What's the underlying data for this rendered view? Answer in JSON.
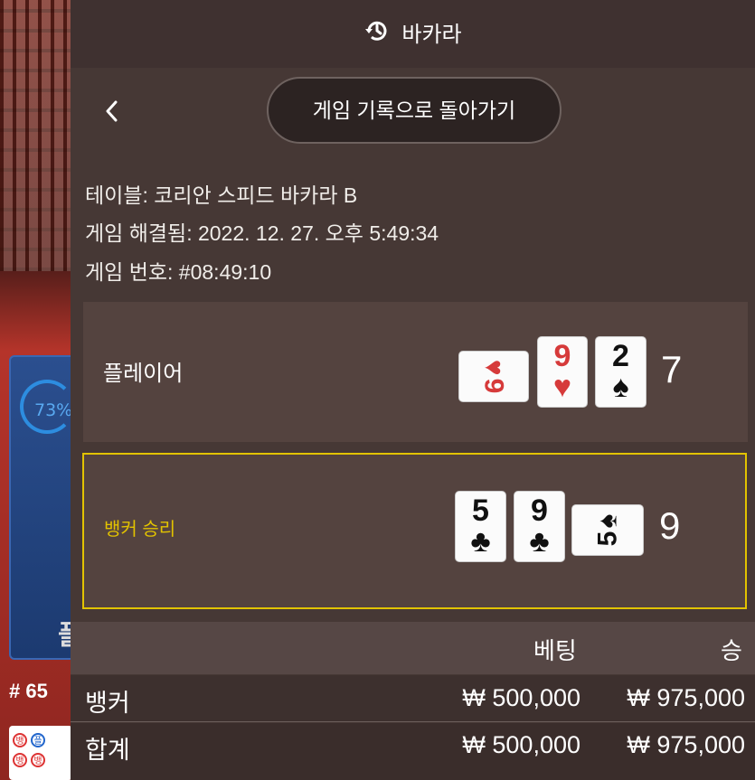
{
  "header": {
    "title": "바카라",
    "icon": "history-icon"
  },
  "back_button": {
    "label": "게임 기록으로 돌아가기"
  },
  "info": {
    "table": "테이블: 코리안 스피드 바카라 B",
    "resolved": "게임 해결됨: 2022. 12. 27. 오후 5:49:34",
    "game_no": "게임 번호: #08:49:10"
  },
  "player": {
    "label": "플레이어",
    "score": "7",
    "cards": [
      {
        "rank": "9",
        "suit": "♥",
        "color": "#d63a3a",
        "sideways": true
      },
      {
        "rank": "9",
        "suit": "♥",
        "color": "#d63a3a",
        "sideways": false
      },
      {
        "rank": "2",
        "suit": "♠",
        "color": "#111111",
        "sideways": false
      }
    ]
  },
  "banker": {
    "label": "뱅커 승리",
    "label_color": "#e2c300",
    "score": "9",
    "cards": [
      {
        "rank": "5",
        "suit": "♣",
        "color": "#111111",
        "sideways": false
      },
      {
        "rank": "9",
        "suit": "♣",
        "color": "#111111",
        "sideways": false
      },
      {
        "rank": "5",
        "suit": "♠",
        "color": "#111111",
        "sideways": true
      }
    ]
  },
  "bets_table": {
    "headers": {
      "bet": "베팅",
      "win": "승"
    },
    "rows": [
      {
        "name": "뱅커",
        "bet": "₩ 500,000",
        "win": "₩ 975,000"
      },
      {
        "name": "합계",
        "bet": "₩ 500,000",
        "win": "₩ 975,000"
      }
    ]
  },
  "background": {
    "percent": "73%",
    "round": "# 65",
    "glyph": "플",
    "road_marks": [
      "뱅",
      "플",
      "뱅",
      "뱅"
    ]
  }
}
